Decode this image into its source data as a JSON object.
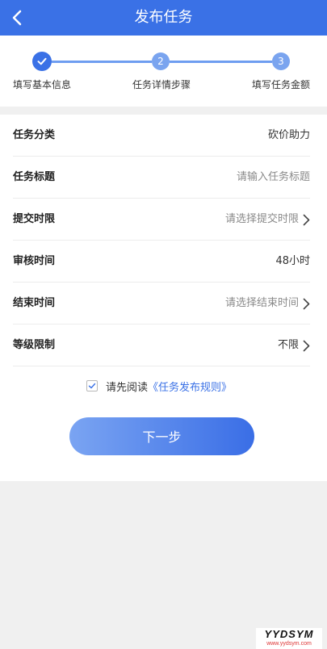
{
  "header": {
    "title": "发布任务",
    "back_icon": "chevron-left-icon"
  },
  "stepper": {
    "steps": [
      {
        "label": "填写基本信息",
        "marker": "✓",
        "status": "done"
      },
      {
        "label": "任务详情步骤",
        "marker": "2",
        "status": "pending"
      },
      {
        "label": "填写任务金额",
        "marker": "3",
        "status": "pending"
      }
    ]
  },
  "form": {
    "rows": [
      {
        "label": "任务分类",
        "value": "砍价助力",
        "is_placeholder": false,
        "chevron": false
      },
      {
        "label": "任务标题",
        "value": "请输入任务标题",
        "is_placeholder": true,
        "chevron": false
      },
      {
        "label": "提交时限",
        "value": "请选择提交时限",
        "is_placeholder": true,
        "chevron": true
      },
      {
        "label": "审核时间",
        "value": "48小时",
        "is_placeholder": false,
        "chevron": false
      },
      {
        "label": "结束时间",
        "value": "请选择结束时间",
        "is_placeholder": true,
        "chevron": true
      },
      {
        "label": "等级限制",
        "value": "不限",
        "is_placeholder": false,
        "chevron": true
      }
    ],
    "agreement": {
      "checked": true,
      "text": "请先阅读",
      "link": "《任务发布规则》"
    },
    "next_button": "下一步"
  },
  "watermark": {
    "brand": "YYDSYM",
    "url": "www.yydsym.com"
  },
  "colors": {
    "primary": "#3a71e6",
    "step_light": "#7aa4ef",
    "link": "#3a71e6",
    "placeholder": "#8a8a8a"
  }
}
